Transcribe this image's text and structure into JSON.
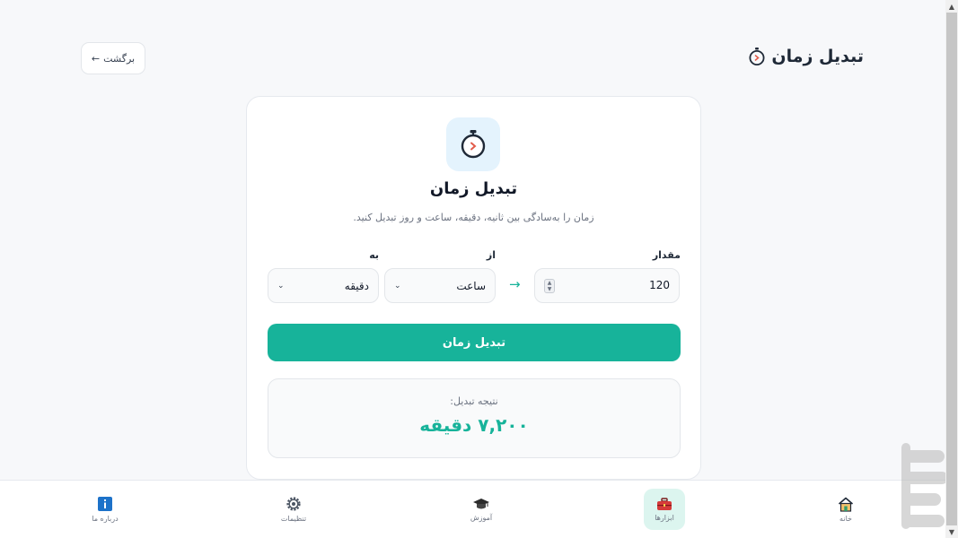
{
  "header": {
    "title": "تبدیل زمان",
    "icon": "stopwatch-icon"
  },
  "back_button": {
    "label": "برگشت",
    "arrow": "←"
  },
  "card": {
    "icon": "stopwatch-icon",
    "title": "تبدیل زمان",
    "description": "زمان را به‌سادگی بین ثانیه، دقیقه، ساعت و روز تبدیل کنید."
  },
  "form": {
    "amount_label": "مقدار",
    "amount_value": "120",
    "from_label": "از",
    "from_value": "ساعت",
    "to_label": "به",
    "to_value": "دقیقه",
    "arrow": "→",
    "convert_label": "تبدیل زمان"
  },
  "result": {
    "label": "نتیجه تبدیل:",
    "value": "۷,۲۰۰ دقیقه"
  },
  "bottom_nav": [
    {
      "label": "خانه",
      "icon": "home-icon",
      "active": false
    },
    {
      "label": "ابزارها",
      "icon": "toolbox-icon",
      "active": true
    },
    {
      "label": "آموزش",
      "icon": "graduation-cap-icon",
      "active": false
    },
    {
      "label": "تنظیمات",
      "icon": "gear-icon",
      "active": false
    },
    {
      "label": "درباره ما",
      "icon": "info-icon",
      "active": false
    }
  ],
  "colors": {
    "accent": "#17b39a",
    "icon_bg": "#e4f3fd",
    "active_nav_bg": "#dcf5ef",
    "background": "#f7f8fa"
  }
}
